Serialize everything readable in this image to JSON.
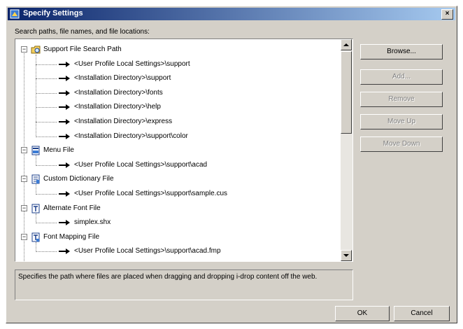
{
  "dialog": {
    "title": "Specify Settings",
    "close_label": "×",
    "section_label": "Search paths, file names, and file locations:",
    "description": "Specifies the path where files are placed when dragging and dropping i-drop content off the web."
  },
  "tree": {
    "expander_glyph": "−",
    "groups": [
      {
        "label": "Support File Search Path",
        "icon": "folder-search-icon",
        "children": [
          "<User Profile Local Settings>\\support",
          "<Installation Directory>\\support",
          "<Installation Directory>\\fonts",
          "<Installation Directory>\\help",
          "<Installation Directory>\\express",
          "<Installation Directory>\\support\\color"
        ]
      },
      {
        "label": "Menu File",
        "icon": "menu-file-icon",
        "children": [
          "<User Profile Local Settings>\\support\\acad"
        ]
      },
      {
        "label": "Custom Dictionary File",
        "icon": "dictionary-file-icon",
        "children": [
          "<User Profile Local Settings>\\support\\sample.cus"
        ]
      },
      {
        "label": "Alternate Font File",
        "icon": "font-file-icon",
        "children": [
          "simplex.shx"
        ]
      },
      {
        "label": "Font Mapping File",
        "icon": "font-mapping-icon",
        "children": [
          "<User Profile Local Settings>\\support\\acad.fmp"
        ]
      }
    ]
  },
  "buttons": {
    "browse": "Browse...",
    "add": "Add...",
    "remove": "Remove",
    "move_up": "Move Up",
    "move_down": "Move Down",
    "ok": "OK",
    "cancel": "Cancel"
  },
  "colors": {
    "face": "#d4d0c8",
    "title_start": "#0a246a",
    "title_end": "#a6caf0",
    "disabled_text": "#808080"
  }
}
